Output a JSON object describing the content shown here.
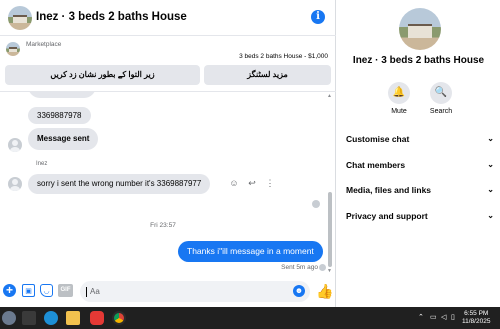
{
  "header": {
    "title": "Inez · 3 beds 2 baths House"
  },
  "marketplace": {
    "label": "Marketplace",
    "listing": "3 beds 2 baths House - $1,000",
    "btn_mark_pending": "زیر التوا کے بطور نشان زد کریں",
    "btn_more_listings": "مزید لسٹنگز"
  },
  "messages": {
    "phone": "3369887978",
    "sent_label": "Message sent",
    "sender_name": "Inez",
    "wrong_number": "sorry i sent the wrong number it's 3369887977",
    "divider_time": "Fri 23:57",
    "my_reply": "Thanks i\"ill message in a moment",
    "status": "Sent 5m ago"
  },
  "composer": {
    "placeholder": "Aa",
    "gif": "GIF"
  },
  "side": {
    "title": "Inez · 3 beds 2 baths House",
    "mute": "Mute",
    "search": "Search",
    "sections": [
      "Customise chat",
      "Chat members",
      "Media, files and links",
      "Privacy and support"
    ]
  },
  "taskbar": {
    "time": "6:55 PM",
    "date": "11/8/2025"
  },
  "colors": {
    "accent": "#1877f2",
    "bubble_gray": "#e4e6eb",
    "taskbar": "#202020"
  }
}
